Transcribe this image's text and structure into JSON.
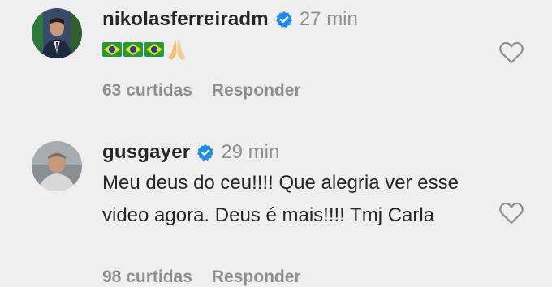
{
  "comments": [
    {
      "username": "nikolasferreiradm",
      "time": "27 min",
      "text_icons": [
        "brazil-flag-emoji",
        "brazil-flag-emoji",
        "brazil-flag-emoji",
        "folded-hands-emoji"
      ],
      "likes": "63 curtidas",
      "reply_label": "Responder"
    },
    {
      "username": "gusgayer",
      "time": "29 min",
      "text": "Meu deus do ceu!!!! Que alegria ver esse video agora. Deus é mais!!!! Tmj Carla",
      "likes": "98 curtidas",
      "reply_label": "Responder"
    }
  ],
  "colors": {
    "verified": "#1d8ef0",
    "muted": "#8e8e8e",
    "text": "#262626",
    "background": "#efefef"
  }
}
